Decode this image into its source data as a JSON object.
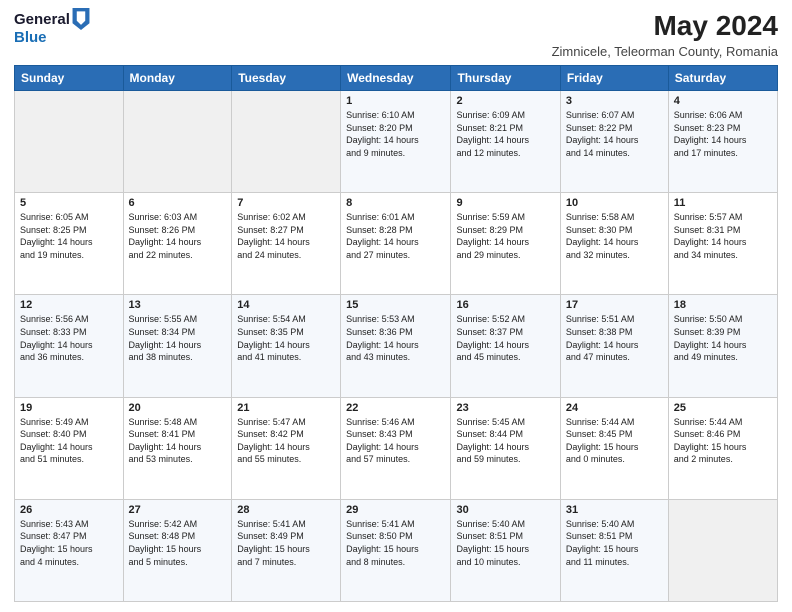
{
  "logo": {
    "general": "General",
    "blue": "Blue"
  },
  "title": "May 2024",
  "subtitle": "Zimnicele, Teleorman County, Romania",
  "headers": [
    "Sunday",
    "Monday",
    "Tuesday",
    "Wednesday",
    "Thursday",
    "Friday",
    "Saturday"
  ],
  "weeks": [
    [
      {
        "day": "",
        "info": ""
      },
      {
        "day": "",
        "info": ""
      },
      {
        "day": "",
        "info": ""
      },
      {
        "day": "1",
        "info": "Sunrise: 6:10 AM\nSunset: 8:20 PM\nDaylight: 14 hours\nand 9 minutes."
      },
      {
        "day": "2",
        "info": "Sunrise: 6:09 AM\nSunset: 8:21 PM\nDaylight: 14 hours\nand 12 minutes."
      },
      {
        "day": "3",
        "info": "Sunrise: 6:07 AM\nSunset: 8:22 PM\nDaylight: 14 hours\nand 14 minutes."
      },
      {
        "day": "4",
        "info": "Sunrise: 6:06 AM\nSunset: 8:23 PM\nDaylight: 14 hours\nand 17 minutes."
      }
    ],
    [
      {
        "day": "5",
        "info": "Sunrise: 6:05 AM\nSunset: 8:25 PM\nDaylight: 14 hours\nand 19 minutes."
      },
      {
        "day": "6",
        "info": "Sunrise: 6:03 AM\nSunset: 8:26 PM\nDaylight: 14 hours\nand 22 minutes."
      },
      {
        "day": "7",
        "info": "Sunrise: 6:02 AM\nSunset: 8:27 PM\nDaylight: 14 hours\nand 24 minutes."
      },
      {
        "day": "8",
        "info": "Sunrise: 6:01 AM\nSunset: 8:28 PM\nDaylight: 14 hours\nand 27 minutes."
      },
      {
        "day": "9",
        "info": "Sunrise: 5:59 AM\nSunset: 8:29 PM\nDaylight: 14 hours\nand 29 minutes."
      },
      {
        "day": "10",
        "info": "Sunrise: 5:58 AM\nSunset: 8:30 PM\nDaylight: 14 hours\nand 32 minutes."
      },
      {
        "day": "11",
        "info": "Sunrise: 5:57 AM\nSunset: 8:31 PM\nDaylight: 14 hours\nand 34 minutes."
      }
    ],
    [
      {
        "day": "12",
        "info": "Sunrise: 5:56 AM\nSunset: 8:33 PM\nDaylight: 14 hours\nand 36 minutes."
      },
      {
        "day": "13",
        "info": "Sunrise: 5:55 AM\nSunset: 8:34 PM\nDaylight: 14 hours\nand 38 minutes."
      },
      {
        "day": "14",
        "info": "Sunrise: 5:54 AM\nSunset: 8:35 PM\nDaylight: 14 hours\nand 41 minutes."
      },
      {
        "day": "15",
        "info": "Sunrise: 5:53 AM\nSunset: 8:36 PM\nDaylight: 14 hours\nand 43 minutes."
      },
      {
        "day": "16",
        "info": "Sunrise: 5:52 AM\nSunset: 8:37 PM\nDaylight: 14 hours\nand 45 minutes."
      },
      {
        "day": "17",
        "info": "Sunrise: 5:51 AM\nSunset: 8:38 PM\nDaylight: 14 hours\nand 47 minutes."
      },
      {
        "day": "18",
        "info": "Sunrise: 5:50 AM\nSunset: 8:39 PM\nDaylight: 14 hours\nand 49 minutes."
      }
    ],
    [
      {
        "day": "19",
        "info": "Sunrise: 5:49 AM\nSunset: 8:40 PM\nDaylight: 14 hours\nand 51 minutes."
      },
      {
        "day": "20",
        "info": "Sunrise: 5:48 AM\nSunset: 8:41 PM\nDaylight: 14 hours\nand 53 minutes."
      },
      {
        "day": "21",
        "info": "Sunrise: 5:47 AM\nSunset: 8:42 PM\nDaylight: 14 hours\nand 55 minutes."
      },
      {
        "day": "22",
        "info": "Sunrise: 5:46 AM\nSunset: 8:43 PM\nDaylight: 14 hours\nand 57 minutes."
      },
      {
        "day": "23",
        "info": "Sunrise: 5:45 AM\nSunset: 8:44 PM\nDaylight: 14 hours\nand 59 minutes."
      },
      {
        "day": "24",
        "info": "Sunrise: 5:44 AM\nSunset: 8:45 PM\nDaylight: 15 hours\nand 0 minutes."
      },
      {
        "day": "25",
        "info": "Sunrise: 5:44 AM\nSunset: 8:46 PM\nDaylight: 15 hours\nand 2 minutes."
      }
    ],
    [
      {
        "day": "26",
        "info": "Sunrise: 5:43 AM\nSunset: 8:47 PM\nDaylight: 15 hours\nand 4 minutes."
      },
      {
        "day": "27",
        "info": "Sunrise: 5:42 AM\nSunset: 8:48 PM\nDaylight: 15 hours\nand 5 minutes."
      },
      {
        "day": "28",
        "info": "Sunrise: 5:41 AM\nSunset: 8:49 PM\nDaylight: 15 hours\nand 7 minutes."
      },
      {
        "day": "29",
        "info": "Sunrise: 5:41 AM\nSunset: 8:50 PM\nDaylight: 15 hours\nand 8 minutes."
      },
      {
        "day": "30",
        "info": "Sunrise: 5:40 AM\nSunset: 8:51 PM\nDaylight: 15 hours\nand 10 minutes."
      },
      {
        "day": "31",
        "info": "Sunrise: 5:40 AM\nSunset: 8:51 PM\nDaylight: 15 hours\nand 11 minutes."
      },
      {
        "day": "",
        "info": ""
      }
    ]
  ]
}
